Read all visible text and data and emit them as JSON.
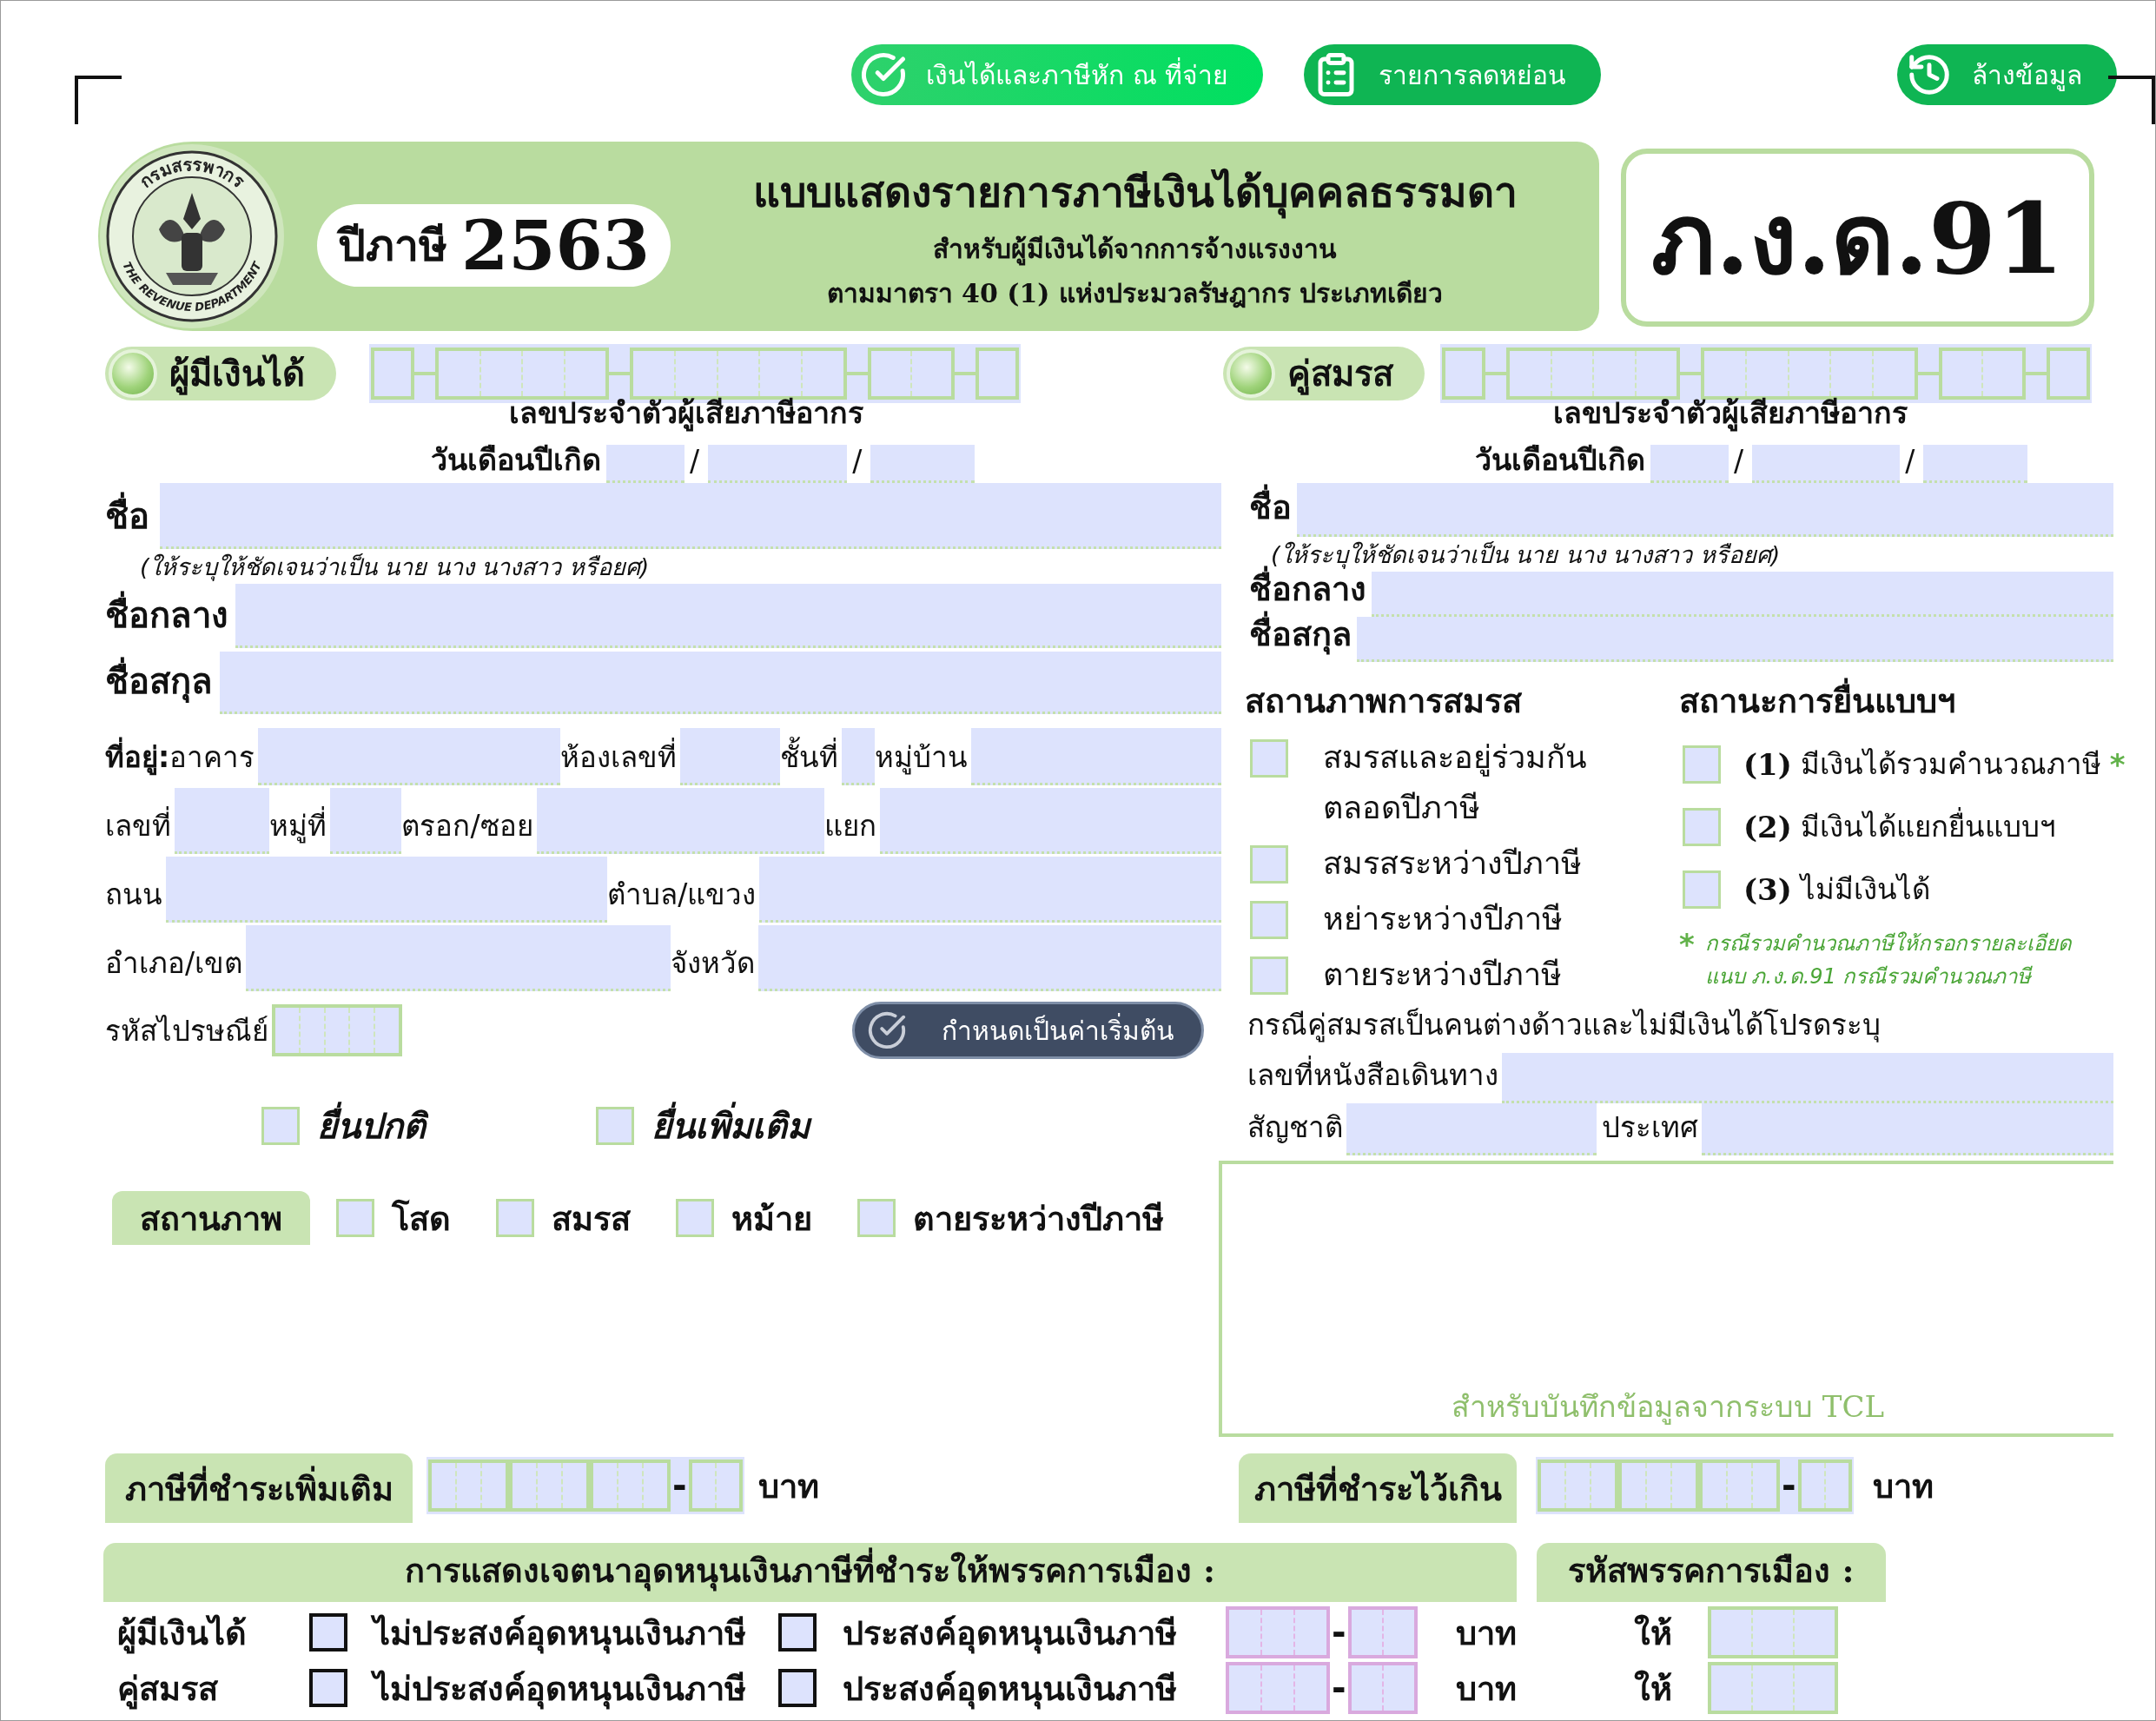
{
  "top_buttons": [
    {
      "kind": "check",
      "label": "เงินได้และภาษีหัก ณ ที่จ่าย"
    },
    {
      "kind": "clipboard",
      "label": "รายการลดหย่อน"
    },
    {
      "kind": "history",
      "label": "ล้างข้อมูล"
    }
  ],
  "header": {
    "seal_top": "กรมสรรพากร",
    "seal_bottom": "THE REVENUE DEPARTMENT",
    "year_label": "ปีภาษี",
    "year": "2563",
    "title": "แบบแสดงรายการภาษีเงินได้บุคคลธรรมดา",
    "subtitle": "สำหรับผู้มีเงินได้จากการจ้างแรงงาน",
    "subtitle_2": "ตามมาตรา 40 (1) แห่งประมวลรัษฎากร ประเภทเดียว",
    "form_code": "ภ.ง.ด.91"
  },
  "taxpayer": {
    "label": "ผู้มีเงินได้",
    "id_label": "เลขประจำตัวผู้เสียภาษีอากร",
    "birth_label": "วันเดือนปีเกิด",
    "date_separators": [
      "/",
      "/"
    ],
    "name_label": "ชื่อ",
    "name_hint": "(ให้ระบุให้ชัดเจนว่าเป็น นาย นาง นางสาว หรือยศ)",
    "middle_name_label": "ชื่อกลาง",
    "surname_label": "ชื่อสกุล",
    "address_rows": [
      [
        "**ที่อยู่:**อาคาร",
        "ห้องเลขที่",
        "ชั้นที่",
        "หมู่บ้าน"
      ],
      [
        "เลขที่",
        "หมู่ที่",
        "ตรอก/ซอย",
        "แยก"
      ],
      [
        "ถนน",
        "ตำบล/แขวง"
      ],
      [
        "อำเภอ/เขต",
        "จังหวัด"
      ]
    ],
    "postal_label": "รหัสไปรษณีย์",
    "default_button": "กำหนดเป็นค่าเริ่มต้น",
    "filing_types": [
      {
        "label": "ยื่นปกติ",
        "checked": false
      },
      {
        "label": "ยื่นเพิ่มเติม",
        "checked": false
      }
    ],
    "status_label": "สถานภาพ",
    "statuses": [
      {
        "label": "โสด",
        "checked": false
      },
      {
        "label": "สมรส",
        "checked": false
      },
      {
        "label": "หม้าย",
        "checked": false
      },
      {
        "label": "ตายระหว่างปีภาษี",
        "checked": false
      }
    ],
    "extra_tax": {
      "label": "ภาษีที่ชำระเพิ่มเติม",
      "separator": "-",
      "currency": "บาท"
    }
  },
  "spouse": {
    "label": "คู่สมรส",
    "id_label": "เลขประจำตัวผู้เสียภาษีอากร",
    "birth_label": "วันเดือนปีเกิด",
    "date_separators": [
      "/",
      "/"
    ],
    "name_label": "ชื่อ",
    "name_hint": "(ให้ระบุให้ชัดเจนว่าเป็น นาย นาง นางสาว หรือยศ)",
    "middle_name_label": "ชื่อกลาง",
    "surname_label": "ชื่อสกุล",
    "marital_title": "สถานภาพการสมรส",
    "marital_statuses": [
      {
        "label": "สมรสและอยู่ร่วมกัน\nตลอดปีภาษี",
        "checked": false
      },
      {
        "label": "สมรสระหว่างปีภาษี",
        "checked": false
      },
      {
        "label": "หย่าระหว่างปีภาษี",
        "checked": false
      },
      {
        "label": "ตายระหว่างปีภาษี",
        "checked": false
      }
    ],
    "filing_title": "สถานะการยื่นแบบฯ",
    "filing_statuses": [
      {
        "number": "(1)",
        "label": "มีเงินได้รวมคำนวณภาษี",
        "mark": "*",
        "checked": false
      },
      {
        "number": "(2)",
        "label": "มีเงินได้แยกยื่นแบบฯ",
        "checked": false
      },
      {
        "number": "(3)",
        "label": "ไม่มีเงินได้",
        "checked": false
      }
    ],
    "filing_note_mark": "*",
    "filing_note": "กรณีรวมคำนวณภาษีให้กรอกรายละเอียดแนบ ภ.ง.ด.91 กรณีรวมคำนวณภาษี",
    "foreign_note": "กรณีคู่สมรสเป็นคนต่างด้าวและไม่มีเงินได้โปรดระบุ",
    "passport_label": "เลขที่หนังสือเดินทาง",
    "nationality_label": "สัญชาติ",
    "country_label": "ประเทศ",
    "tcl_caption": "สำหรับบันทึกข้อมูลจากระบบ TCL",
    "overpaid_tax": {
      "label": "ภาษีที่ชำระไว้เกิน",
      "separator": "-",
      "currency": "บาท"
    }
  },
  "political": {
    "title": "การแสดงเจตนาอุดหนุนเงินภาษีที่ชำระให้พรรคการเมือง :",
    "code_title": "รหัสพรรคการเมือง :",
    "rows": [
      {
        "person": "ผู้มีเงินได้",
        "options": [
          {
            "label": "ไม่ประสงค์อุดหนุนเงินภาษี",
            "checked": false
          },
          {
            "label": "ประสงค์อุดหนุนเงินภาษี",
            "checked": false
          }
        ],
        "separator": "-",
        "currency": "บาท",
        "give": "ให้"
      },
      {
        "person": "คู่สมรส",
        "options": [
          {
            "label": "ไม่ประสงค์อุดหนุนเงินภาษี",
            "checked": false
          },
          {
            "label": "ประสงค์อุดหนุนเงินภาษี",
            "checked": false
          }
        ],
        "separator": "-",
        "currency": "บาท",
        "give": "ให้"
      }
    ]
  }
}
